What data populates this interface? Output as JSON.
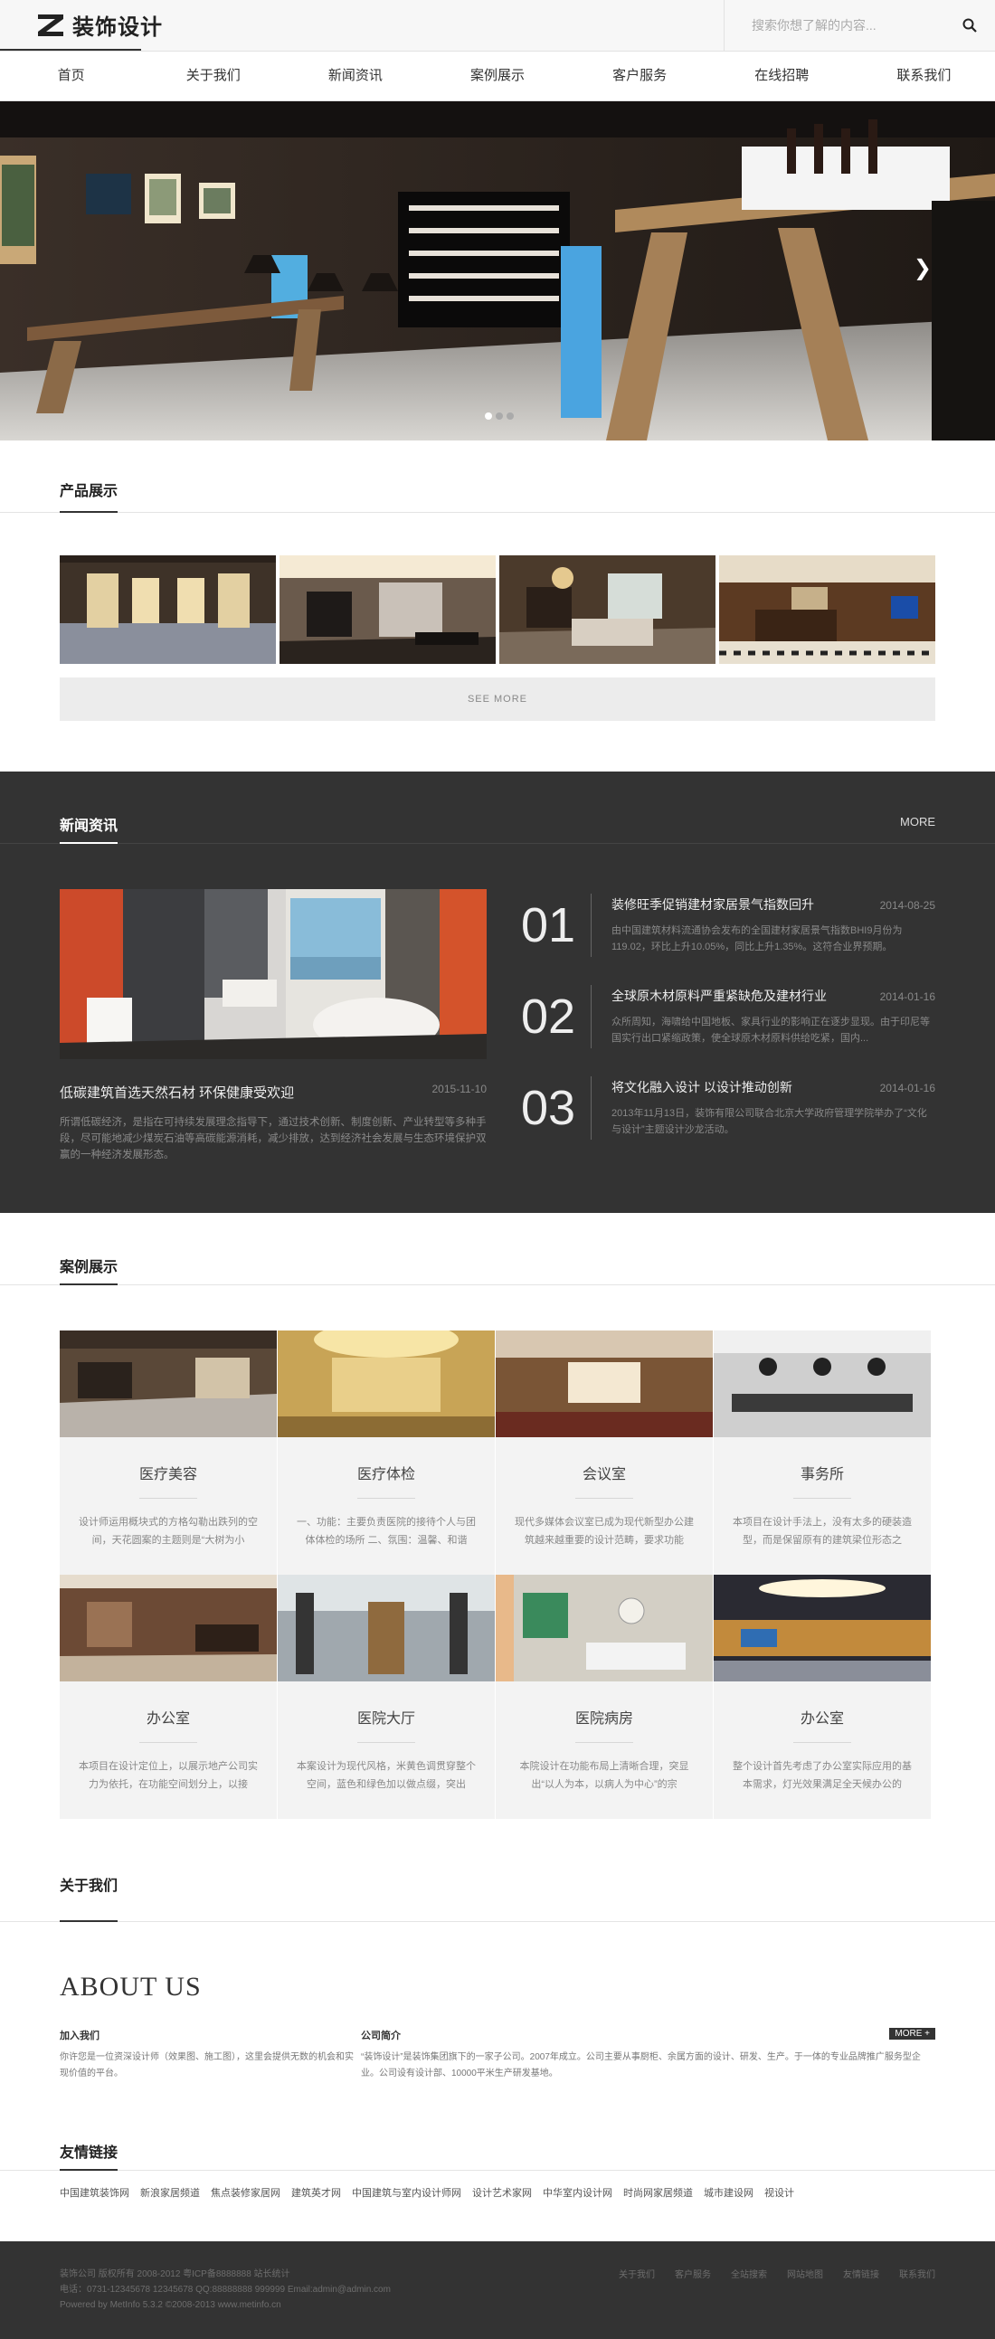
{
  "brand": {
    "name": "装饰设计"
  },
  "search": {
    "placeholder": "搜索你想了解的内容..."
  },
  "nav": [
    "首页",
    "关于我们",
    "新闻资讯",
    "案例展示",
    "客户服务",
    "在线招聘",
    "联系我们"
  ],
  "hero": {
    "slides": 3,
    "active_slide": 1
  },
  "products": {
    "title": "产品展示",
    "see_more": "SEE MORE"
  },
  "news": {
    "title": "新闻资讯",
    "more": "MORE",
    "lead": {
      "title": "低碳建筑首选天然石材 环保健康受欢迎",
      "date": "2015-11-10",
      "desc": "所谓低碳经济，是指在可持续发展理念指导下，通过技术创新、制度创新、产业转型等多种手段，尽可能地减少煤炭石油等高碳能源消耗，减少排放，达到经济社会发展与生态环境保护双赢的一种经济发展形态。"
    },
    "items": [
      {
        "num": "01",
        "title": "装修旺季促销建材家居景气指数回升",
        "date": "2014-08-25",
        "desc": "由中国建筑材料流通协会发布的全国建材家居景气指数BHI9月份为119.02，环比上升10.05%，同比上升1.35%。这符合业界预期。"
      },
      {
        "num": "02",
        "title": "全球原木材原料严重紧缺危及建材行业",
        "date": "2014-01-16",
        "desc": "众所周知，海啸给中国地板、家具行业的影响正在逐步显现。由于印尼等国实行出口紧缩政策，使全球原木材原料供给吃紧，国内..."
      },
      {
        "num": "03",
        "title": "将文化融入设计 以设计推动创新",
        "date": "2014-01-16",
        "desc": "2013年11月13日，装饰有限公司联合北京大学政府管理学院举办了“文化与设计”主题设计沙龙活动。"
      }
    ]
  },
  "cases": {
    "title": "案例展示",
    "items": [
      {
        "title": "医疗美容",
        "desc": "设计师运用概块式的方格勾勒出跌列的空间，天花圆案的主题则是“大树为小"
      },
      {
        "title": "医疗体检",
        "desc": "一、功能：主要负责医院的接待个人与团体体检的场所 二、氛围：温馨、和谐"
      },
      {
        "title": "会议室",
        "desc": "现代多媒体会议室已成为现代新型办公建筑越来越重要的设计范畴，要求功能"
      },
      {
        "title": "事务所",
        "desc": "本项目在设计手法上，没有太多的硬装造型，而是保留原有的建筑梁位形态之"
      },
      {
        "title": "办公室",
        "desc": "本项目在设计定位上，以展示地产公司实力为依托，在功能空间划分上，以接"
      },
      {
        "title": "医院大厅",
        "desc": "本案设计为现代风格，米黄色调贯穿整个空间，蓝色和绿色加以做点缀，突出"
      },
      {
        "title": "医院病房",
        "desc": "本院设计在功能布局上清晰合理，突显出“以人为本，以病人为中心”的宗"
      },
      {
        "title": "办公室",
        "desc": "整个设计首先考虑了办公室实际应用的基本需求，灯光效果满足全天候办公的"
      }
    ]
  },
  "about": {
    "title": "关于我们",
    "big": "ABOUT US",
    "join_title": "加入我们",
    "join_text": "你许您是一位资深设计师（效果图、施工图），这里会提供无数的机会和实现价值的平台。",
    "intro_title": "公司简介",
    "intro_text": "“装饰设计”是装饰集团旗下的一家子公司。2007年成立。公司主要从事厨柜、余属方面的设计、研发、生产。于一体的专业品牌推广服务型企业。公司设有设计部、10000平米生产研发基地。",
    "more": "MORE +"
  },
  "links": {
    "title": "友情链接",
    "items": [
      "中国建筑装饰网",
      "新浪家居频道",
      "焦点装修家居网",
      "建筑英才网",
      "中国建筑与室内设计师网",
      "设计艺术家网",
      "中华室内设计网",
      "时尚网家居频道",
      "城市建设网",
      "视设计"
    ]
  },
  "footer": {
    "line1": "装饰公司 版权所有 2008-2012 粤ICP备8888888 站长统计",
    "line2": "电话：0731-12345678 12345678 QQ:88888888 999999 Email:admin@admin.com",
    "line3": "Powered by MetInfo 5.3.2 ©2008-2013 www.metinfo.cn",
    "links": [
      "关于我们",
      "客户服务",
      "全站搜索",
      "网站地图",
      "友情链接",
      "联系我们"
    ]
  },
  "colors": {
    "dark": "#333333",
    "light_bg": "#f7f7f7",
    "card_bg": "#f3f3f3"
  }
}
